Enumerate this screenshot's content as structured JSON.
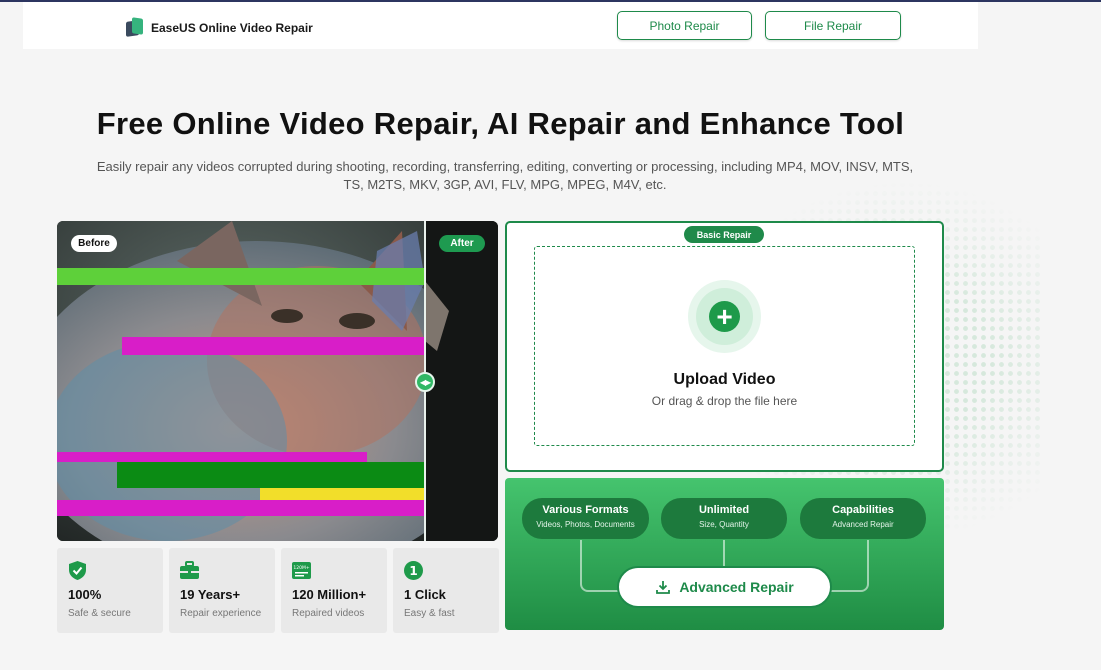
{
  "header": {
    "brand_name": "EaseUS Online Video Repair",
    "nav": [
      {
        "label": "Photo Repair"
      },
      {
        "label": "File Repair"
      }
    ]
  },
  "hero": {
    "title": "Free Online Video Repair, AI Repair and Enhance Tool",
    "subtitle": "Easily repair any videos corrupted during shooting, recording, transferring, editing, converting or processing, including MP4, MOV, INSV, MTS, TS, M2TS, MKV, 3GP, AVI, FLV, MPG, MPEG, M4V, etc."
  },
  "preview": {
    "before_label": "Before",
    "after_label": "After"
  },
  "stats": [
    {
      "icon": "shield-check-icon",
      "value": "100%",
      "label": "Safe & secure"
    },
    {
      "icon": "toolbox-icon",
      "value": "19 Years+",
      "label": "Repair experience"
    },
    {
      "icon": "video-count-icon",
      "icon_text": "120M+",
      "value": "120 Million+",
      "label": "Repaired videos"
    },
    {
      "icon": "number-one-icon",
      "icon_text": "1",
      "value": "1 Click",
      "label": "Easy & fast"
    }
  ],
  "upload": {
    "badge": "Basic Repair",
    "title": "Upload Video",
    "subtitle": "Or drag & drop the file here"
  },
  "advanced": {
    "features": [
      {
        "title": "Various Formats",
        "sub": "Videos, Photos, Documents"
      },
      {
        "title": "Unlimited",
        "sub": "Size, Quantity"
      },
      {
        "title": "Capabilities",
        "sub": "Advanced Repair"
      }
    ],
    "button_label": "Advanced Repair"
  },
  "colors": {
    "accent": "#1e8a4a",
    "accent_light": "#45c46e",
    "page_bg": "#f5f5f5"
  }
}
